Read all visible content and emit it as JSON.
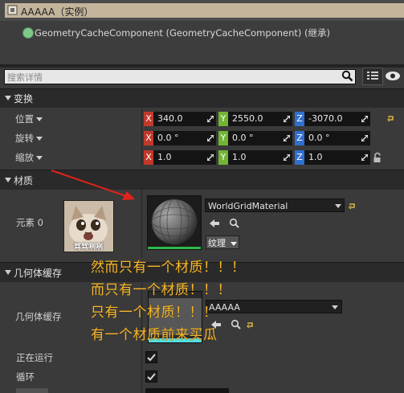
{
  "header": {
    "title": "AAAAA（实例）",
    "component_label": "GeometryCacheComponent (GeometryCacheComponent) (继承)"
  },
  "search": {
    "placeholder": "搜索详情"
  },
  "transform": {
    "section_label": "变换",
    "rows": [
      {
        "label": "位置",
        "x": "340.0",
        "y": "2550.0",
        "z": "-3070.0"
      },
      {
        "label": "旋转",
        "x": "0.0 °",
        "y": "0.0 °",
        "z": "0.0 °"
      },
      {
        "label": "缩放",
        "x": "1.0",
        "y": "1.0",
        "z": "1.0"
      }
    ],
    "axis_x": "X",
    "axis_y": "Y",
    "axis_z": "Z"
  },
  "material": {
    "section_label": "材质",
    "element_label": "元素 0",
    "meme_caption": "骂骂咧咧",
    "material_name": "WorldGridMaterial",
    "texture_button": "纹理"
  },
  "geometry_cache": {
    "section_label": "几何体缓存",
    "field_label": "几何体缓存",
    "value": "AAAAA",
    "running_label": "正在运行",
    "looping_label": "循环",
    "running_checked": true,
    "looping_checked": true
  },
  "annotations": [
    "然而只有一个材质！！！",
    "而只有一个材质！！！",
    "只有一个材质！！！",
    "有一个材质前来买瓜"
  ],
  "colors": {
    "annotation": "#f6b62c",
    "arrow": "#e0231b",
    "axis_x": "#c1392b",
    "axis_y": "#71b534",
    "axis_z": "#2f6fcf"
  }
}
